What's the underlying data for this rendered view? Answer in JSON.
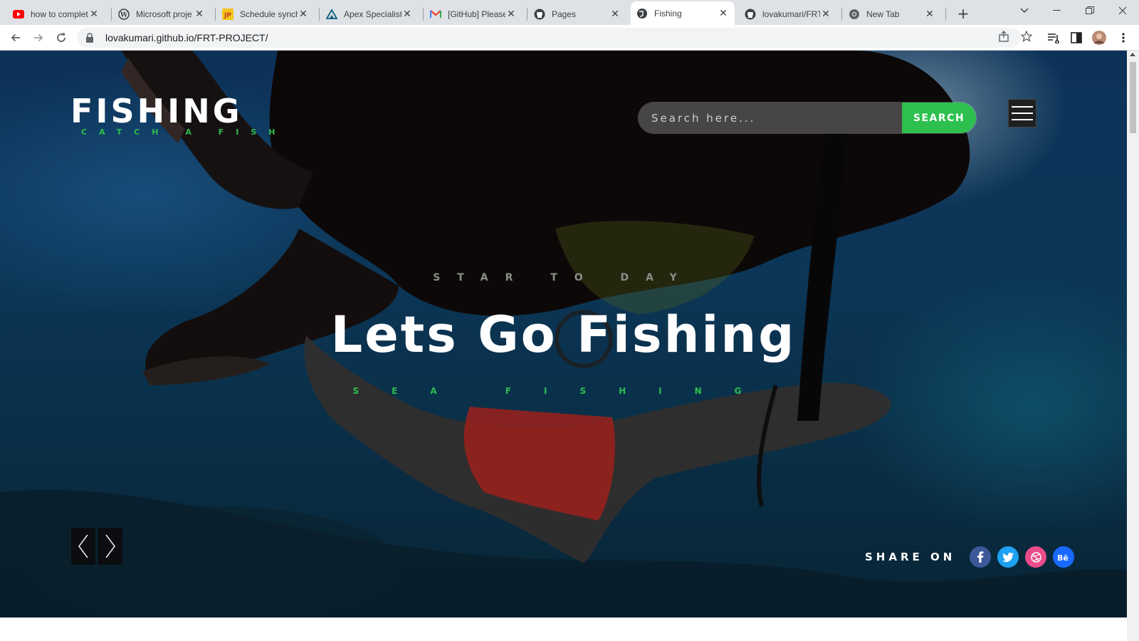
{
  "browser": {
    "tabs": [
      {
        "title": "how to complet",
        "icon": "youtube-icon"
      },
      {
        "title": "Microsoft proje",
        "icon": "wordpress-icon"
      },
      {
        "title": "Schedule synch",
        "icon": "jp-icon"
      },
      {
        "title": "Apex Specialist",
        "icon": "trailhead-icon"
      },
      {
        "title": "[GitHub] Please",
        "icon": "gmail-icon"
      },
      {
        "title": "Pages",
        "icon": "github-icon"
      },
      {
        "title": "Fishing",
        "icon": "globe-icon",
        "active": true
      },
      {
        "title": "lovakumari/FRT",
        "icon": "github-icon"
      },
      {
        "title": "New Tab",
        "icon": "chrome-icon"
      }
    ],
    "url": "lovakumari.github.io/FRT-PROJECT/"
  },
  "site": {
    "logo_name": "FISHING",
    "logo_tagline": "CATCH A FISH",
    "search_placeholder": "Search here...",
    "search_button": "SEARCH",
    "eyebrow": "STAR TO DAY",
    "headline": "Lets Go Fishing",
    "subline": "SEA FISHING",
    "share_label": "SHARE ON",
    "social": [
      {
        "name": "facebook-icon",
        "glyph": "f",
        "color": "#3b5998"
      },
      {
        "name": "twitter-icon",
        "glyph": "t",
        "color": "#1da1f2"
      },
      {
        "name": "dribbble-icon",
        "glyph": "◎",
        "color": "#ea4c89"
      },
      {
        "name": "behance-icon",
        "glyph": "Bē",
        "color": "#1769ff"
      }
    ]
  }
}
